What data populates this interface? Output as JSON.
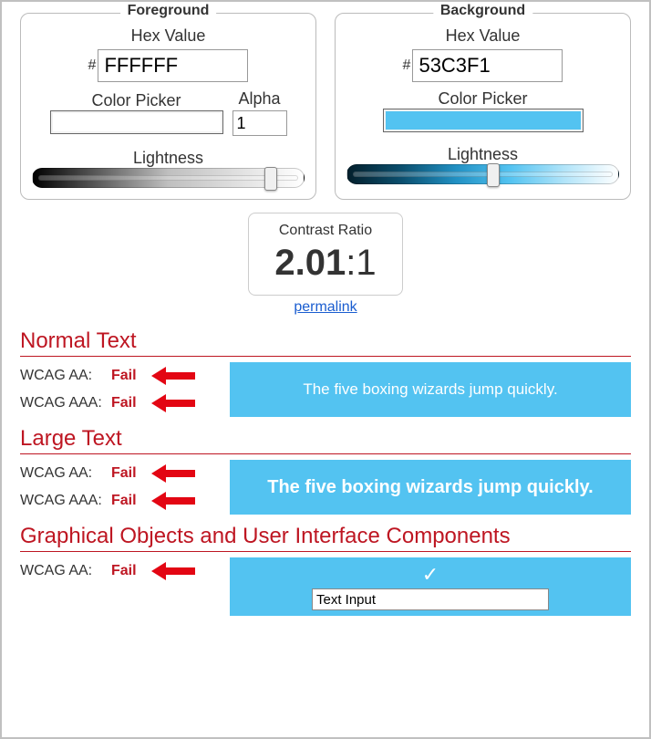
{
  "foreground": {
    "title": "Foreground",
    "hex_label": "Hex Value",
    "hex_value": "FFFFFF",
    "color_picker_label": "Color Picker",
    "alpha_label": "Alpha",
    "alpha_value": "1",
    "lightness_label": "Lightness",
    "swatch_color": "#FFFFFF",
    "gradient": "linear-gradient(to right, #000000, #BFBFBF, #FFFFFF)",
    "thumb_pos_pct": 88
  },
  "background": {
    "title": "Background",
    "hex_label": "Hex Value",
    "hex_value": "53C3F1",
    "color_picker_label": "Color Picker",
    "lightness_label": "Lightness",
    "swatch_color": "#53C3F1",
    "gradient": "linear-gradient(to right, #031F2C, #0B4F6E, #2190C3, #53C3F1, #B1E4F9, #FFFFFF)",
    "thumb_pos_pct": 54
  },
  "contrast": {
    "label": "Contrast Ratio",
    "ratio_bold": "2.01",
    "ratio_rest": ":1",
    "permalink_text": "permalink"
  },
  "sections": {
    "normal": {
      "title": "Normal Text",
      "aa_label": "WCAG AA:",
      "aa_status": "Fail",
      "aaa_label": "WCAG AAA:",
      "aaa_status": "Fail",
      "sample_text": "The five boxing wizards jump quickly."
    },
    "large": {
      "title": "Large Text",
      "aa_label": "WCAG AA:",
      "aa_status": "Fail",
      "aaa_label": "WCAG AAA:",
      "aaa_status": "Fail",
      "sample_text": "The five boxing wizards jump quickly."
    },
    "ui": {
      "title": "Graphical Objects and User Interface Components",
      "aa_label": "WCAG AA:",
      "aa_status": "Fail",
      "check_glyph": "✓",
      "text_input_value": "Text Input"
    }
  },
  "colors": {
    "fail": "#BE1622",
    "arrow": "#E30613",
    "sample_bg": "#53C3F1",
    "sample_fg": "#FFFFFF"
  }
}
